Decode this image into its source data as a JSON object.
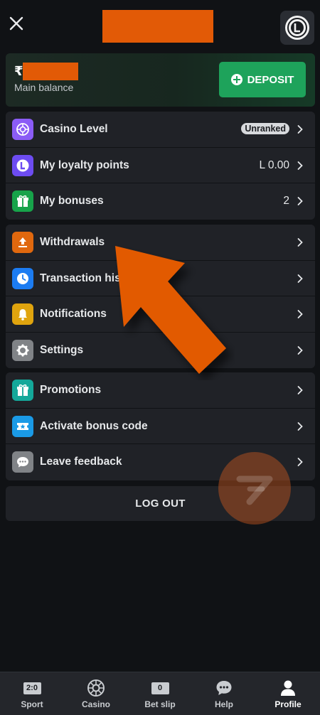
{
  "header": {
    "close_icon": "close-icon",
    "brand_icon": "brand-logo-icon"
  },
  "balance": {
    "currency_symbol": "₹",
    "label": "Main balance",
    "deposit_label": "DEPOSIT"
  },
  "groups": [
    {
      "items": [
        {
          "label": "Casino Level",
          "badge": "Unranked",
          "icon": "casino-level-icon",
          "color": "#8b5cf6"
        },
        {
          "label": "My loyalty points",
          "value": "L 0.00",
          "icon": "loyalty-points-icon",
          "color": "#6d4cf2"
        },
        {
          "label": "My bonuses",
          "value": "2",
          "icon": "gift-icon",
          "color": "#17a34a"
        }
      ]
    },
    {
      "items": [
        {
          "label": "Withdrawals",
          "icon": "withdraw-icon",
          "color": "#e0680e"
        },
        {
          "label": "Transaction history",
          "icon": "clock-icon",
          "color": "#1c7cf2"
        },
        {
          "label": "Notifications",
          "icon": "bell-icon",
          "color": "#e0a40e"
        },
        {
          "label": "Settings",
          "icon": "gear-icon",
          "color": "#808387"
        }
      ]
    },
    {
      "items": [
        {
          "label": "Promotions",
          "icon": "gift-icon",
          "color": "#14a89a"
        },
        {
          "label": "Activate bonus code",
          "icon": "ticket-star-icon",
          "color": "#1a9ae6"
        },
        {
          "label": "Leave feedback",
          "icon": "chat-bubble-icon",
          "color": "#808387"
        }
      ]
    }
  ],
  "logout": {
    "label": "LOG OUT"
  },
  "nav": [
    {
      "label": "Sport",
      "score": "2:0",
      "icon": "scoreboard-icon"
    },
    {
      "label": "Casino",
      "icon": "roulette-icon"
    },
    {
      "label": "Bet slip",
      "score": "0",
      "icon": "bet-slip-icon"
    },
    {
      "label": "Help",
      "icon": "chat-help-icon"
    },
    {
      "label": "Profile",
      "icon": "profile-icon",
      "active": true
    }
  ],
  "colors": {
    "accent_green": "#1ea35b",
    "background": "#101215",
    "row_background": "#202227",
    "annotation_orange": "#e25a06"
  }
}
